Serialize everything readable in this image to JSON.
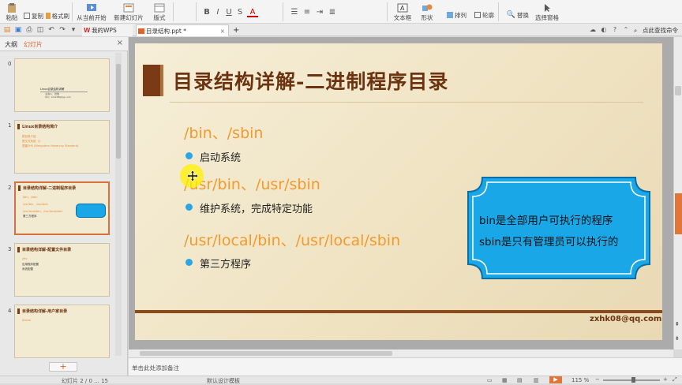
{
  "ribbon": {
    "paste": "粘贴",
    "copy": "复制",
    "format_painter": "格式刷",
    "from_current": "从当前开始",
    "new_slide": "新建幻灯片",
    "layout": "版式",
    "text_box": "文本框",
    "shape": "形状",
    "arrange": "排列",
    "outline": "轮廓",
    "replace": "替换",
    "select_pane": "选择窗格",
    "fmt_b": "B",
    "fmt_i": "I",
    "fmt_u": "U",
    "fmt_s": "S",
    "fmt_a": "A"
  },
  "tabs": {
    "home": "我的WPS",
    "file": "目录结构.ppt *",
    "add": "+",
    "help": "点此查找命令"
  },
  "pane": {
    "outline": "大纲",
    "slides": "幻灯片",
    "close": "×",
    "add_button": "+"
  },
  "thumbs": [
    {
      "num": "0",
      "title": "Linux目录结构详解",
      "lines": [
        "主讲人：张弛",
        "QQ：zxhk08@qq.com"
      ]
    },
    {
      "num": "1",
      "title": "Linux目录结构简介",
      "lines": [
        "根目录介绍",
        "根文件系统（/）",
        "遵循FHS (Filesystem Hierarchy Standard)"
      ]
    },
    {
      "num": "2",
      "title": "目录结构详解-二进制程序目录",
      "lines": [
        "/bin、/sbin",
        "/usr/bin、/usr/sbin",
        "/usr/local/bin、/usr/local/sbin",
        "第三方程序"
      ]
    },
    {
      "num": "3",
      "title": "目录结构详解-配置文件目录",
      "lines": [
        "/etc",
        "应用程序配置",
        "系统配置"
      ]
    },
    {
      "num": "4",
      "title": "目录结构详解-用户家目录",
      "lines": [
        "/home"
      ]
    }
  ],
  "slide": {
    "title": "目录结构详解-二进制程序目录",
    "sections": [
      {
        "heading": "/bin、/sbin",
        "bullet": "启动系统"
      },
      {
        "heading": "/usr/bin、/usr/sbin",
        "bullet": "维护系统，完成特定功能"
      },
      {
        "heading": "/usr/local/bin、/usr/local/sbin",
        "bullet": "第三方程序"
      }
    ],
    "callout": [
      "bin是全部用户可执行的程序",
      "sbin是只有管理员可以执行的"
    ],
    "email": "zxhk08@qq.com"
  },
  "notes": {
    "placeholder": "单击此处添加备注"
  },
  "status": {
    "slide_counter": "幻灯片 2 / 0 ... 15",
    "template": "默认设计模板",
    "zoom": "115 %"
  },
  "colors": {
    "accent_orange": "#f39a2c",
    "title_brown": "#6b3310",
    "callout_blue": "#1aa7e8",
    "bullet_blue": "#2aa6e6"
  }
}
